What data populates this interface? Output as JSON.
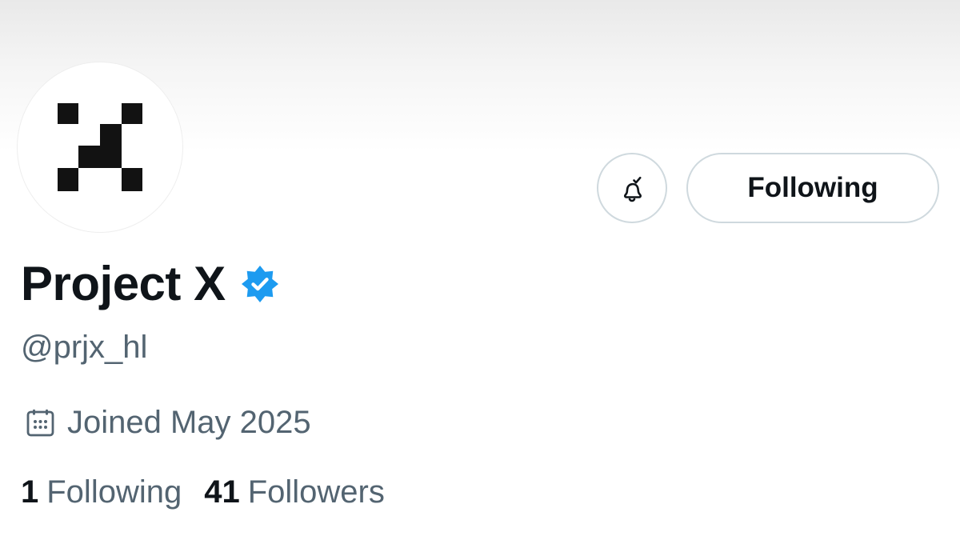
{
  "profile": {
    "display_name": "Project X",
    "handle": "@prjx_hl",
    "joined": "Joined May 2025",
    "verified": true
  },
  "actions": {
    "follow_label": "Following",
    "notification_state": "subscribed"
  },
  "stats": {
    "following_count": "1",
    "following_label": "Following",
    "followers_count": "41",
    "followers_label": "Followers"
  },
  "colors": {
    "verified_badge": "#1d9bf0",
    "primary_text": "#0f1419",
    "secondary_text": "#536471",
    "border": "#cfd9de"
  },
  "icons": {
    "avatar": "project-x-logo",
    "bell": "bell-check-icon",
    "verified": "verified-badge-icon",
    "calendar": "calendar-icon"
  }
}
